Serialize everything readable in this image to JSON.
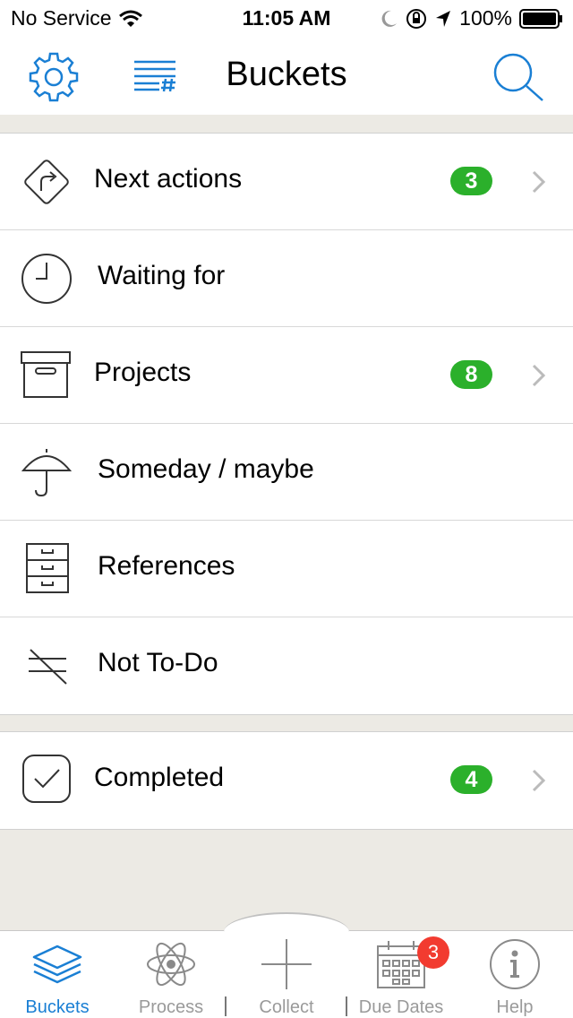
{
  "status": {
    "carrier": "No Service",
    "time": "11:05 AM",
    "battery": "100%"
  },
  "nav": {
    "title": "Buckets",
    "icons": [
      "gear-icon",
      "list-hash-icon",
      "search-icon"
    ]
  },
  "buckets": [
    {
      "label": "Next actions",
      "badge": "3",
      "icon": "turn-right-sign-icon"
    },
    {
      "label": "Waiting for",
      "icon": "clock-icon"
    },
    {
      "label": "Projects",
      "badge": "8",
      "icon": "archive-box-icon"
    },
    {
      "label": "Someday / maybe",
      "icon": "umbrella-icon"
    },
    {
      "label": "References",
      "icon": "file-cabinet-icon"
    },
    {
      "label": "Not To-Do",
      "icon": "strikethrough-list-icon"
    }
  ],
  "completed": {
    "label": "Completed",
    "badge": "4",
    "icon": "checkbox-icon"
  },
  "tabs": [
    {
      "label": "Buckets",
      "icon": "stack-icon",
      "active": true
    },
    {
      "label": "Process",
      "icon": "atom-icon"
    },
    {
      "label": "Collect",
      "icon": "plus-icon"
    },
    {
      "label": "Due Dates",
      "icon": "calendar-icon",
      "badge": "3"
    },
    {
      "label": "Help",
      "icon": "info-icon"
    }
  ],
  "colors": {
    "accent": "#1a7fd4",
    "badge_green": "#2bb02b",
    "badge_red": "#f23b30",
    "background": "#eceae4"
  }
}
